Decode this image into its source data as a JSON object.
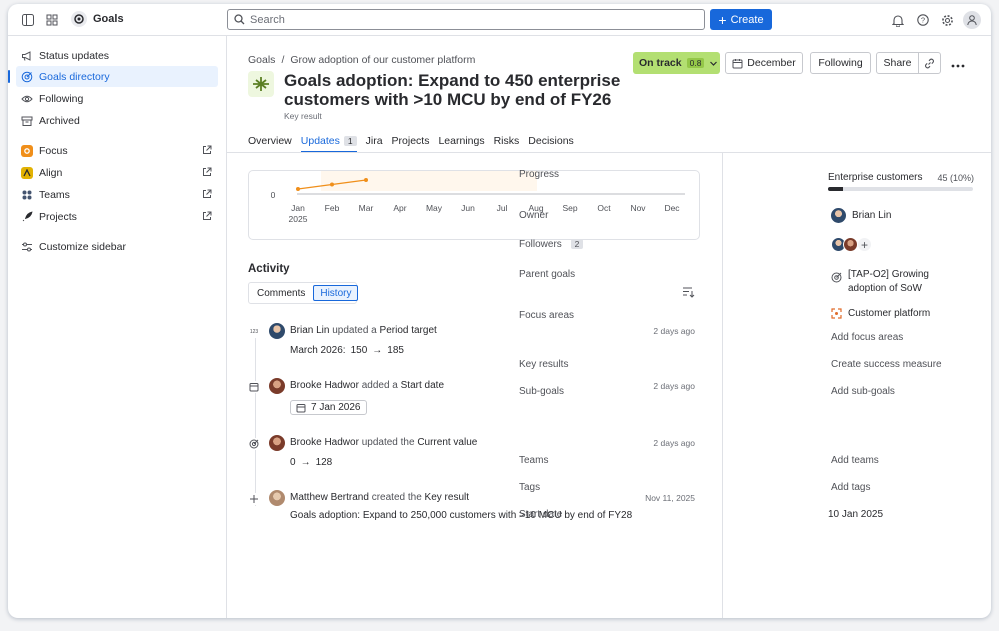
{
  "topbar": {
    "app_name": "Goals",
    "search_placeholder": "Search",
    "create_label": "Create"
  },
  "sidebar": {
    "items": [
      {
        "label": "Status updates"
      },
      {
        "label": "Goals directory"
      },
      {
        "label": "Following"
      },
      {
        "label": "Archived"
      }
    ],
    "apps": [
      {
        "label": "Focus",
        "color": "#f08f1a"
      },
      {
        "label": "Align",
        "color": "#e2b203"
      },
      {
        "label": "Teams",
        "color": "#44546f"
      },
      {
        "label": "Projects",
        "color": "#292a2e"
      }
    ],
    "customize_label": "Customize sidebar"
  },
  "header": {
    "breadcrumb_root": "Goals",
    "breadcrumb_sep": "/",
    "breadcrumb_parent": "Grow adoption of our customer platform",
    "title": "Goals adoption: Expand to 450 enterprise customers with >10 MCU by end of FY26",
    "subtitle": "Key result",
    "status_label": "On track",
    "status_score": "0.8",
    "date_label": "December",
    "following_label": "Following",
    "share_label": "Share"
  },
  "tabs": [
    {
      "label": "Overview"
    },
    {
      "label": "Updates",
      "count": "1"
    },
    {
      "label": "Jira"
    },
    {
      "label": "Projects"
    },
    {
      "label": "Learnings"
    },
    {
      "label": "Risks"
    },
    {
      "label": "Decisions"
    }
  ],
  "chart_data": {
    "type": "line",
    "title": "",
    "x": [
      "Jan",
      "Feb",
      "Mar",
      "Apr",
      "May",
      "Jun",
      "Jul",
      "Aug",
      "Sep",
      "Oct",
      "Nov",
      "Dec"
    ],
    "x_year": "2025",
    "y_tick": "0",
    "points": [
      {
        "x": "Jan",
        "y": 0
      },
      {
        "x": "Feb",
        "y": 0.15
      },
      {
        "x": "Mar",
        "y": 0.3
      }
    ],
    "series_color": "#f08f1a"
  },
  "activity": {
    "heading": "Activity",
    "tabs": [
      "Comments",
      "History"
    ],
    "items": [
      {
        "user": "Brian Lin",
        "verb": "updated a",
        "object": "Period target",
        "time": "2 days ago",
        "detail_label": "March 2026:",
        "from": "150",
        "arrow": "→",
        "to": "185",
        "icon": "123"
      },
      {
        "user": "Brooke Hadwor",
        "verb": "added a",
        "object": "Start date",
        "time": "2 days ago",
        "date": "7 Jan 2026"
      },
      {
        "user": "Brooke Hadwor",
        "verb": "updated the",
        "object": "Current value",
        "time": "2 days ago",
        "from": "0",
        "arrow": "→",
        "to": "128"
      },
      {
        "user": "Matthew Bertrand",
        "verb": "created the",
        "object": "Key result",
        "time": "Nov 11, 2025",
        "detail": "Goals adoption: Expand to 250,000 customers with >10 MCU by end of FY28"
      }
    ]
  },
  "details": {
    "progress_label": "Progress",
    "progress_name": "Enterprise customers",
    "progress_value": "45 (10%)",
    "progress_fraction": 0.1,
    "owner_label": "Owner",
    "owner": "Brian Lin",
    "followers_label": "Followers",
    "followers_count": "2",
    "parent_label": "Parent goals",
    "parent_goal": "[TAP-O2] Growing adoption of SoW",
    "focus_label": "Focus areas",
    "focus_area": "Customer platform",
    "add_focus": "Add focus areas",
    "kr_label": "Key results",
    "kr_action": "Create success measure",
    "subgoals_label": "Sub-goals",
    "subgoals_action": "Add sub-goals",
    "teams_label": "Teams",
    "teams_action": "Add teams",
    "tags_label": "Tags",
    "tags_action": "Add tags",
    "start_label": "Start date",
    "start_date": "10 Jan 2025"
  }
}
